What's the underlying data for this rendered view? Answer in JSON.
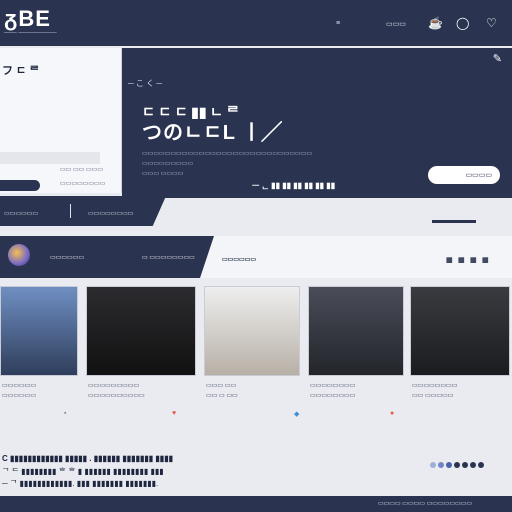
{
  "header": {
    "logo": "ᵹBE",
    "logo_sub": "─── ─────────",
    "nav_text": "≡",
    "menu_text": "▭▭▭",
    "icons": [
      {
        "name": "cup-icon",
        "glyph": "☕"
      },
      {
        "name": "ring-icon",
        "glyph": "◯"
      },
      {
        "name": "heart-icon",
        "glyph": "♡"
      }
    ]
  },
  "left_panel": {
    "title": "フ ㄷ ᄅ",
    "input_placeholder": "",
    "links": [
      "▭▭▭▭▭▭▭▭",
      "▭▭ ▭▭ ▭▭▭"
    ]
  },
  "hero": {
    "nav": "─ こ く ─",
    "line1": "ㄷ ㄷ ㄷ ▮▮ ㄴ ᄅ",
    "title": "つのㄴㄷL ㅣ╱",
    "lines": [
      "▭▭▭▭▭▭▭▭▭▭▭▭▭▭▭▭▭▭▭▭▭▭▭▭▭▭▭▭▭▭",
      "▭▭▭▭▭▭▭▭▭",
      "▭▭▭ ▭▭▭▭"
    ],
    "caption": "ᅳ ᆫ ▮▮ ▮▮ ▮▮ ▮▮ ▮▮ ▮▮",
    "pill_label": "▭▭▭▭"
  },
  "tabs": [
    "▭▭▭▭▭▭",
    "▭▭▭▭▭▭▭▭"
  ],
  "ribbon": {
    "label1": "▭▭▭▭▭▭",
    "label2": "▭ ▭▭▭▭▭▭▭▭",
    "label3": "▭▭▭▭▭▭",
    "icons": [
      "▦",
      "▦",
      "▦",
      "▦"
    ]
  },
  "cards": [
    {
      "title": "▭▭▭▭▭▭",
      "line": "▭▭▭▭▭▭",
      "bg": "#5a7bb0"
    },
    {
      "title": "▭▭▭▭▭▭▭▭▭",
      "line": "▭▭▭▭▭▭▭▭▭▭",
      "bg": "#1e1e22"
    },
    {
      "title": "▭▭▭ ▭▭",
      "line": "▭▭ ▭ ▭▭",
      "bg": "#d8d3cc"
    },
    {
      "title": "▭▭▭▭▭▭▭▭",
      "line": "▭▭▭▭▭▭▭▭",
      "bg": "#3d3f48"
    },
    {
      "title": "▭▭▭▭▭▭▭▭",
      "line": "▭▭ ▭▭▭▭▭",
      "bg": "#2a2b2f"
    }
  ],
  "footer": {
    "line1": "C ▮▮▮▮▮▮▮▮▮▮▮▮ ▮▮▮▮▮ . ▮▮▮▮▮▮ ▮▮▮▮▮▮▮ ▮▮▮▮",
    "line2": "ᄀ ᄃ ▮▮▮▮▮▮▮▮ ᄒ ᄒ ▮ ▮▮▮▮▮▮ ▮▮▮▮▮▮▮▮ ▮▮▮",
    "line3": "─ ᄀ ▮▮▮▮▮▮▮▮▮▮▮▮. ▮▮▮ ▮▮▮▮▮▮▮ ▮▮▮▮▮▮▮.",
    "dot_colors": [
      "#9fb0d8",
      "#6f87c6",
      "#4a62aa",
      "#2a3450",
      "#2a3450",
      "#2a3450",
      "#2a3450"
    ]
  },
  "bottombar": {
    "text": "▭▭▭▭  ▭▭▭▭  ▭▭▭▭▭▭▭▭"
  },
  "colors": {
    "primary": "#2a3450",
    "accent": "#e4594a"
  }
}
